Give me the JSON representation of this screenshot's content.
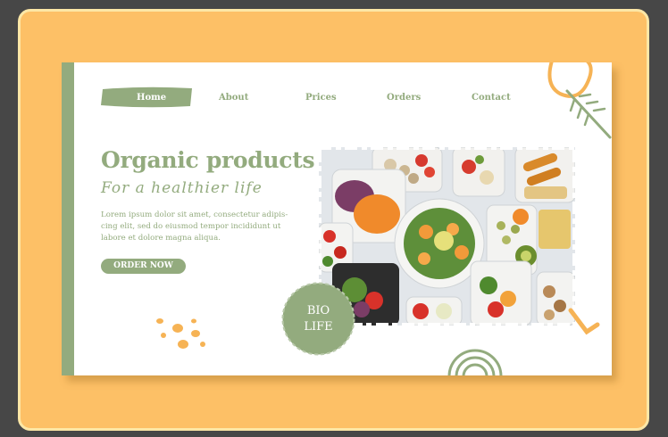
{
  "nav": {
    "items": [
      {
        "id": "home",
        "label": "Home",
        "active": true
      },
      {
        "id": "about",
        "label": "About"
      },
      {
        "id": "prices",
        "label": "Prices"
      },
      {
        "id": "orders",
        "label": "Orders"
      },
      {
        "id": "contact",
        "label": "Contact"
      }
    ]
  },
  "hero": {
    "title": "Organic products",
    "subtitle": "For a healthier life",
    "description_lines": [
      "Lorem ipsum dolor sit amet, consectetur adipis-",
      "cing elit, sed do eiusmod tempor incididunt ut",
      "labore et dolore magna aliqua."
    ],
    "cta_label": "ORDER NOW"
  },
  "badge": {
    "line1": "BIO",
    "line2": "LIFE"
  },
  "colors": {
    "background": "#474747",
    "frame": "#fdc066",
    "frame_border": "#fde7a6",
    "accent_green": "#93ab7e",
    "accent_orange": "#f6b355",
    "card": "#ffffff"
  },
  "icons": [
    "leaf-sprig-icon",
    "orange-squiggle-icon",
    "orange-dots-icon",
    "green-arc-icon",
    "orange-checkmark-icon"
  ]
}
